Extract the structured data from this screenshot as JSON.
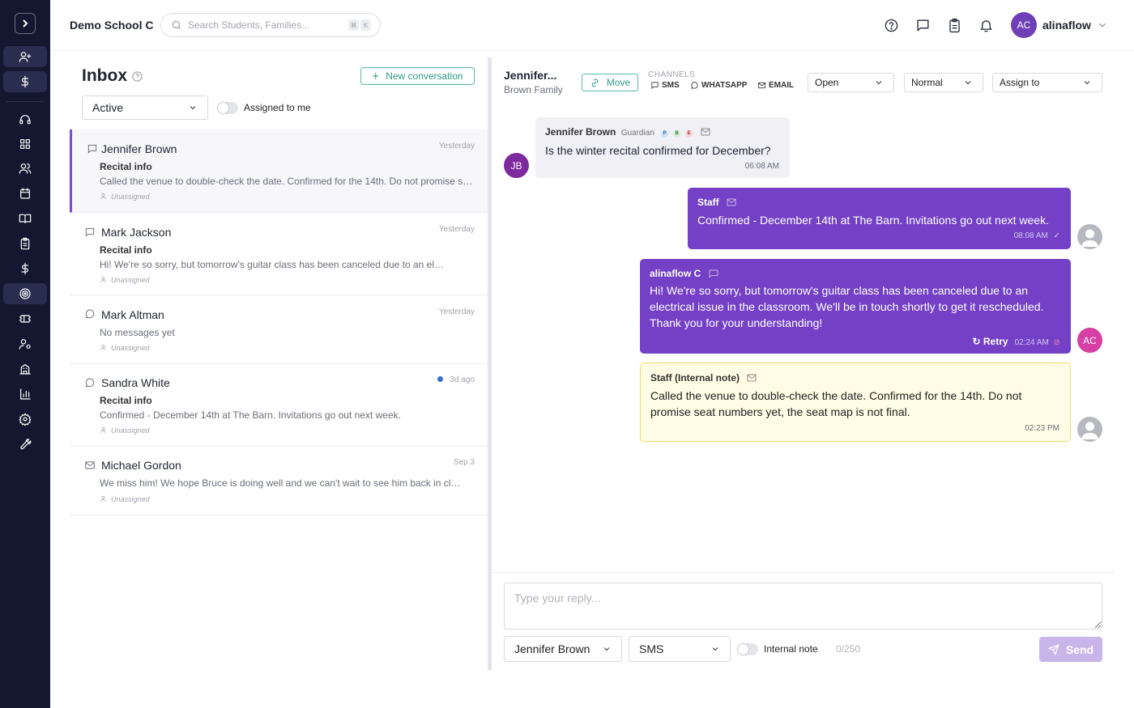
{
  "app": {
    "school_name": "Demo School C"
  },
  "search": {
    "placeholder": "Search Students, Families...",
    "kbd_1": "⌘",
    "kbd_2": "K"
  },
  "user": {
    "initials": "AC",
    "name": "alinaflow"
  },
  "inbox": {
    "title": "Inbox",
    "new_conversation_label": "New conversation",
    "status_filter": "Active",
    "assigned_to_me_label": "Assigned to me",
    "conversations": [
      {
        "name": "Jennifer Brown",
        "time": "Yesterday",
        "subject": "Recital info",
        "preview": "Called the venue to double-check the date. Confirmed for the 14th. Do not promise seat numbers yet, the seat map is not final.",
        "assignee": "Unassigned"
      },
      {
        "name": "Mark Jackson",
        "time": "Yesterday",
        "subject": "Recital info",
        "preview": "Hi! We're so sorry, but tomorrow's guitar class has been canceled due to an electrical issue in the classroom.",
        "assignee": "Unassigned"
      },
      {
        "name": "Mark Altman",
        "time": "Yesterday",
        "preview": "No messages yet",
        "assignee": "Unassigned"
      },
      {
        "name": "Sandra White",
        "time": "3d ago",
        "subject": "Recital info",
        "preview": "Confirmed - December 14th at The Barn. Invitations go out next week.",
        "assignee": "Unassigned"
      },
      {
        "name": "Michael Gordon",
        "time": "Sep 3",
        "preview": "We miss him! We hope Bruce is doing well and we can't wait to see him back in class soon.",
        "assignee": "Unassigned"
      }
    ]
  },
  "chat": {
    "contact_name": "Jennifer...",
    "family": "Brown Family",
    "move_label": "Move",
    "channels_label": "CHANNELS",
    "channels": [
      "SMS",
      "WHATSAPP",
      "EMAIL"
    ],
    "status_value": "Open",
    "priority_value": "Normal",
    "assign_placeholder": "Assign to",
    "messages": [
      {
        "sender": "Jennifer Brown",
        "role": "Guardian",
        "badges": [
          "P",
          "B",
          "E"
        ],
        "text": "Is the winter recital confirmed for December?",
        "time": "06:08 AM",
        "avatar": "JB"
      },
      {
        "sender": "Staff",
        "text": "Confirmed - December 14th at The Barn. Invitations go out next week.",
        "time": "08:08 AM"
      },
      {
        "sender": "alinaflow C",
        "text": "Hi! We're so sorry, but tomorrow's guitar class has been canceled due to an electrical issue in the classroom. We'll be in touch shortly to get it rescheduled. Thank you for your understanding!",
        "retry_label": "Retry",
        "time": "02:24 AM",
        "avatar": "AC"
      },
      {
        "sender": "Staff (Internal note)",
        "text": "Called the venue to double-check the date. Confirmed for the 14th. Do not promise seat numbers yet, the seat map is not final.",
        "time": "02:23 PM"
      }
    ]
  },
  "composer": {
    "placeholder": "Type your reply...",
    "recipient": "Jennifer Brown",
    "channel": "SMS",
    "internal_note_label": "Internal note",
    "char_count": "0/250",
    "send_label": "Send"
  },
  "colors": {
    "sidebar_bg": "#141730",
    "accent_purple": "#7440c6",
    "accent_teal": "#2e9c87",
    "note_bg": "#fffde6",
    "note_border": "#eedc6c"
  }
}
